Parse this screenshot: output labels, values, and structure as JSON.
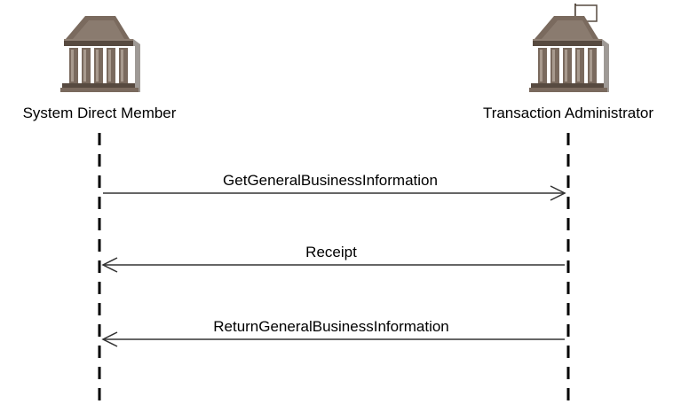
{
  "actors": [
    {
      "name": "System Direct Member",
      "icon": "bank-building-icon"
    },
    {
      "name": "Transaction Administrator",
      "icon": "bank-building-flag-icon"
    }
  ],
  "messages": [
    {
      "label": "GetGeneralBusinessInformation",
      "from": "System Direct Member",
      "to": "Transaction Administrator"
    },
    {
      "label": "Receipt",
      "from": "Transaction Administrator",
      "to": "System Direct Member"
    },
    {
      "label": "ReturnGeneralBusinessInformation",
      "from": "Transaction Administrator",
      "to": "System Direct Member"
    }
  ],
  "colors": {
    "icon_fill": "#7a6a5e",
    "icon_light": "#a89a8e",
    "icon_dark": "#574a40",
    "line": "#000000",
    "arrow": "#333333"
  }
}
